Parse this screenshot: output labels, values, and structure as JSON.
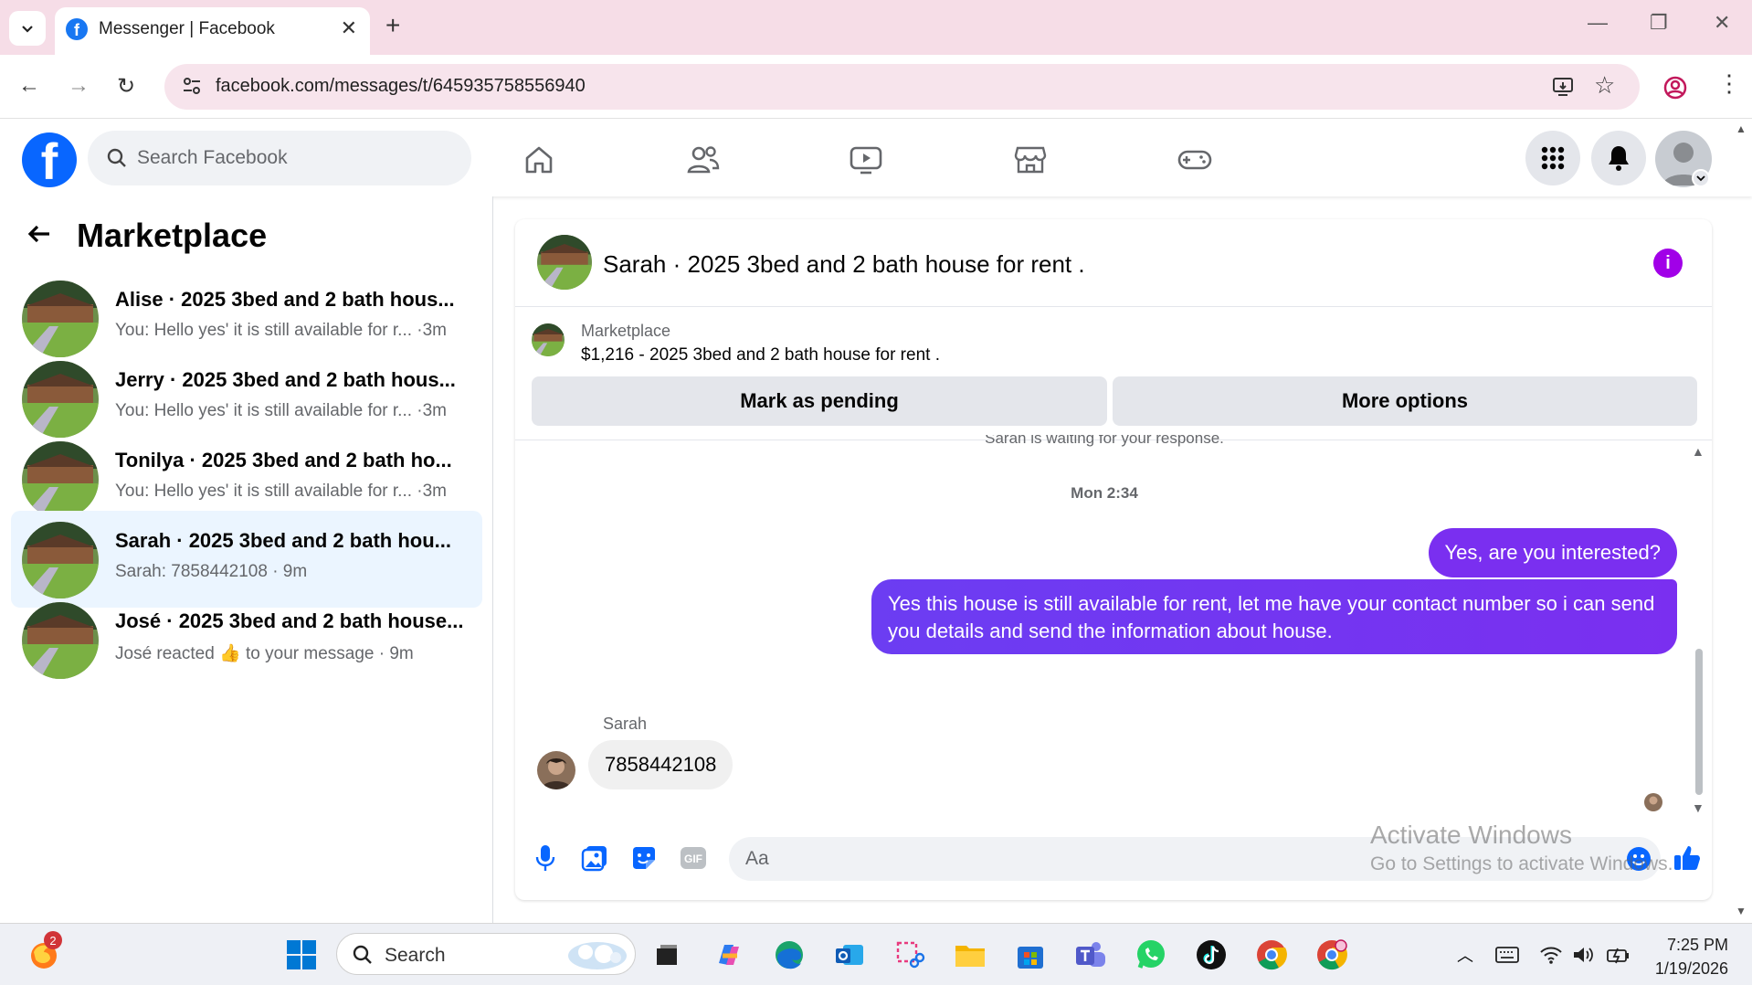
{
  "browser": {
    "tab_title": "Messenger | Facebook",
    "url": "facebook.com/messages/t/645935758556940"
  },
  "fb": {
    "search_placeholder": "Search Facebook"
  },
  "sidebar": {
    "title": "Marketplace",
    "conversations": [
      {
        "name": "Alise · 2025 3bed and 2 bath hous...",
        "preview": "You: Hello yes' it is still available for r... ·3m",
        "active": false
      },
      {
        "name": "Jerry · 2025 3bed and 2 bath hous...",
        "preview": "You: Hello yes' it is still available for r... ·3m",
        "active": false
      },
      {
        "name": "Tonilya · 2025 3bed and 2 bath ho...",
        "preview": "You: Hello yes' it is still available for r... ·3m",
        "active": false
      },
      {
        "name": "Sarah · 2025 3bed and 2 bath hou...",
        "preview": "Sarah: 7858442108 · 9m",
        "active": true
      },
      {
        "name": "José · 2025 3bed and 2 bath house...",
        "preview": "José reacted 👍 to your message · 9m",
        "active": false
      }
    ]
  },
  "chat": {
    "title": "Sarah · 2025 3bed and 2 bath house for rent .",
    "info_icon": "i",
    "listing_label": "Marketplace",
    "listing_price": "$1,216 - 2025 3bed and 2 bath house for rent .",
    "mark_pending": "Mark as pending",
    "more_options": "More options",
    "waiting_notice": "Sarah is waiting for your response.",
    "timestamp": "Mon 2:34",
    "outgoing_1": "Yes, are you interested?",
    "outgoing_2": "Yes this house is still available for rent, let me have your contact number so i can send you details and send the information about house.",
    "sender_name": "Sarah",
    "incoming_1": "7858442108",
    "composer_placeholder": "Aa"
  },
  "watermark": {
    "line1": "Activate Windows",
    "line2": "Go to Settings to activate Windows."
  },
  "taskbar": {
    "search_placeholder": "Search",
    "time": "7:25 PM",
    "date": "1/19/2026",
    "firefox_badge": "2"
  },
  "colors": {
    "fb_blue": "#0866ff",
    "messenger_purple": "#7a2ff0",
    "active_row": "#ebf5ff",
    "tabstrip": "#f6dde7"
  }
}
